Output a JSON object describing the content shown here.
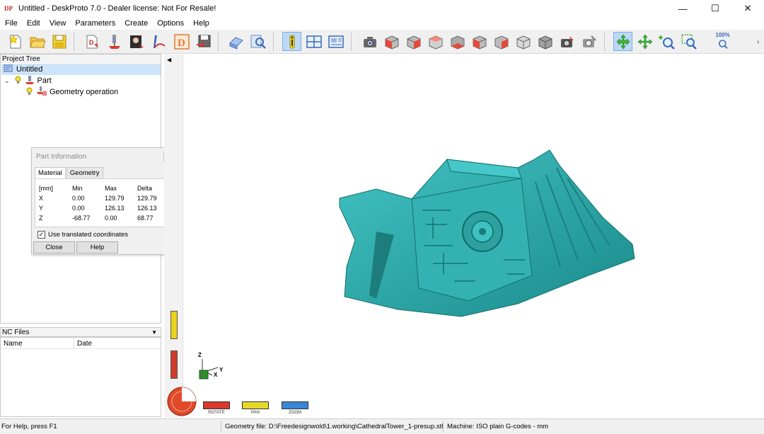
{
  "window": {
    "title": "Untitled - DeskProto 7.0 - Dealer license: Not For Resale!",
    "logo_text": "DP",
    "buttons": {
      "minimize": "—",
      "maximize": "☐",
      "close": "✕"
    }
  },
  "menu": [
    "File",
    "Edit",
    "View",
    "Parameters",
    "Create",
    "Options",
    "Help"
  ],
  "toolbar": {
    "zoom_label": "100%",
    "buttons": [
      "new-project",
      "open-project",
      "save-project",
      "load-part",
      "add-operation",
      "load-bitmap",
      "draw-vector",
      "create-3d",
      "save-nc",
      "simulation",
      "preview",
      "info",
      "split-view",
      "layout",
      "camera-view",
      "view-front",
      "view-back",
      "view-left",
      "view-right",
      "view-top",
      "view-bottom",
      "view-iso",
      "view-iso-2",
      "render",
      "render-2",
      "rotate-mode",
      "pan-mode",
      "zoom-mode",
      "zoom-window",
      "zoom-100"
    ]
  },
  "project_tree": {
    "header": "Project Tree",
    "items": [
      {
        "label": "Untitled",
        "level": 0,
        "selected": true
      },
      {
        "label": "Part",
        "level": 1
      },
      {
        "label": "Geometry operation",
        "level": 2
      }
    ]
  },
  "part_info": {
    "title": "Part Information",
    "tabs": [
      "Material",
      "Geometry"
    ],
    "active_tab": "Material",
    "columns": [
      "[mm]",
      "Min",
      "Max",
      "Delta"
    ],
    "rows": [
      {
        "axis": "X",
        "min": "0.00",
        "max": "129.79",
        "delta": "129.79"
      },
      {
        "axis": "Y",
        "min": "0.00",
        "max": "126.13",
        "delta": "126.13"
      },
      {
        "axis": "Z",
        "min": "-68.77",
        "max": "0.00",
        "delta": "68.77"
      }
    ],
    "checkbox_label": "Use translated coordinates",
    "checkbox_checked": true,
    "close_label": "Close",
    "help_label": "Help"
  },
  "nc_files": {
    "header": "NC Files",
    "columns": [
      "Name",
      "Date"
    ]
  },
  "viewport": {
    "model_color": "#2aa7a7",
    "axes": {
      "z": "Z",
      "y": "Y",
      "x": "X"
    },
    "controls": [
      {
        "label": "ROTATE",
        "color": "#d9392b"
      },
      {
        "label": "PAN",
        "color": "#e6d82a"
      },
      {
        "label": "ZOOM",
        "color": "#3a86d6"
      }
    ]
  },
  "status": {
    "help": "For Help, press F1",
    "geometry_file": "Geometry file: D:\\Freedesignwold\\1.working\\CathedralTower_1-presup.stl",
    "machine": "Machine: ISO plain G-codes - mm"
  }
}
